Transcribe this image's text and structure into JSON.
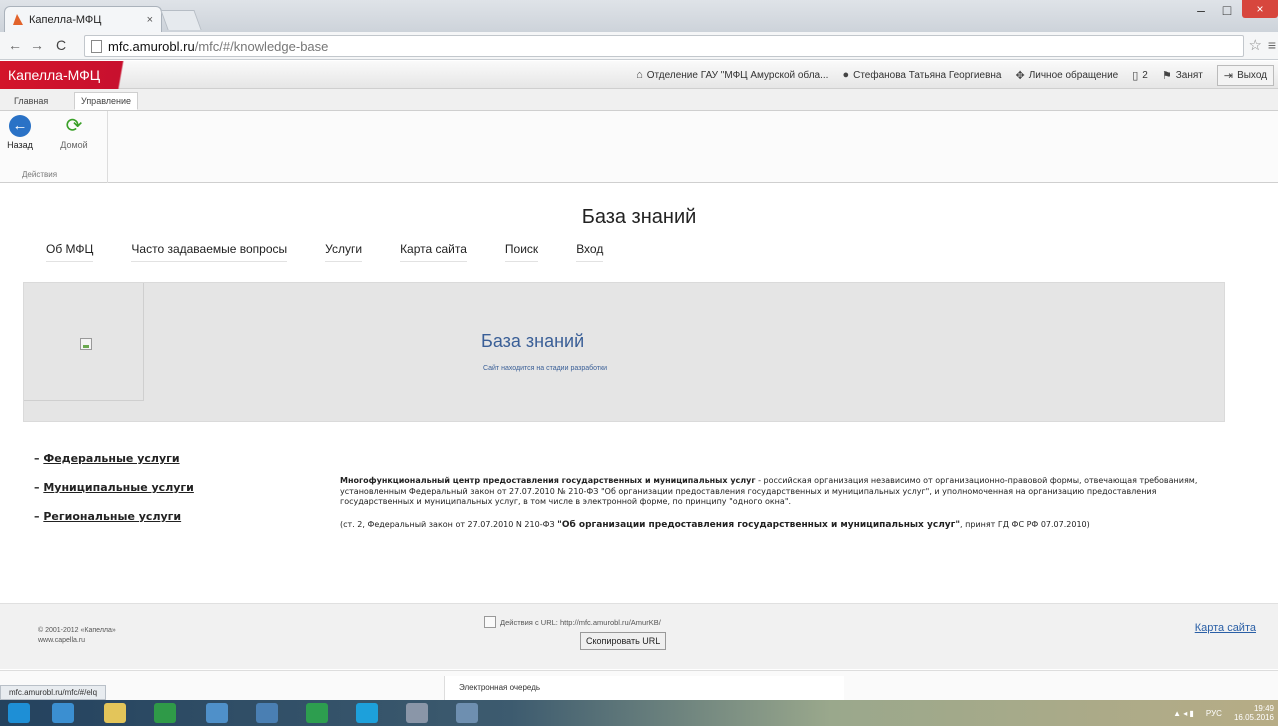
{
  "browser": {
    "tab_title": "Капелла-МФЦ",
    "tab_close": "×",
    "url_host": "mfc.amurobl.ru",
    "url_path": "/mfc/#/knowledge-base",
    "win_min": "–",
    "win_max": "□",
    "win_close": "×"
  },
  "app": {
    "logo": "Капелла-МФЦ",
    "header": {
      "office": "Отделение ГАУ \"МФЦ Амурской обла...",
      "user": "Стефанова Татьяна Георгиевна",
      "personal": "Личное обращение",
      "count": "2",
      "status": "Занят",
      "logout": "Выход"
    }
  },
  "ribbon": {
    "tabs": [
      "Главная",
      "Управление"
    ],
    "back_label": "Назад",
    "home_label": "Домой",
    "group_label": "Действия"
  },
  "page": {
    "title": "База знаний",
    "nav": [
      "Об МФЦ",
      "Часто задаваемые вопросы",
      "Услуги",
      "Карта сайта",
      "Поиск",
      "Вход"
    ],
    "hero": {
      "title": "База знаний",
      "subtitle": "Сайт находится на стадии разработки"
    },
    "links": [
      "Федеральные услуги",
      "Муниципальные услуги",
      "Региональные услуги"
    ],
    "desc": {
      "bold1": "Многофункциональный центр предоставления государственных и муниципальных услуг",
      "text1": " - российская организация независимо от организационно-правовой формы, отвечающая требованиям, установленным Федеральный закон от 27.07.2010 № 210-ФЗ \"Об организации предоставления государственных и муниципальных услуг\", и уполномоченная на организацию предоставления государственных и муниципальных услуг, в том числе в электронной форме, по принципу \"одного окна\".",
      "text2": "(ст. 2, Федеральный закон от 27.07.2010 N 210-ФЗ ",
      "bold2": "\"Об организации предоставления государственных и муниципальных услуг\"",
      "text3": ", принят ГД ФС РФ 07.07.2010)"
    }
  },
  "footer": {
    "copyright": "© 2001-2012 «Капелла»",
    "site": "www.capella.ru",
    "url_actions": "Действия с URL: http://mfc.amurobl.ru/AmurKB/",
    "copy_button": "Скопировать URL",
    "sitemap": "Карта сайта"
  },
  "status": {
    "hover_url": "mfc.amurobl.ru/mfc/#/elq",
    "queue_tab": "Электронная очередь"
  },
  "taskbar": {
    "lang": "РУС",
    "time": "19:49",
    "date": "16.05.2016"
  }
}
